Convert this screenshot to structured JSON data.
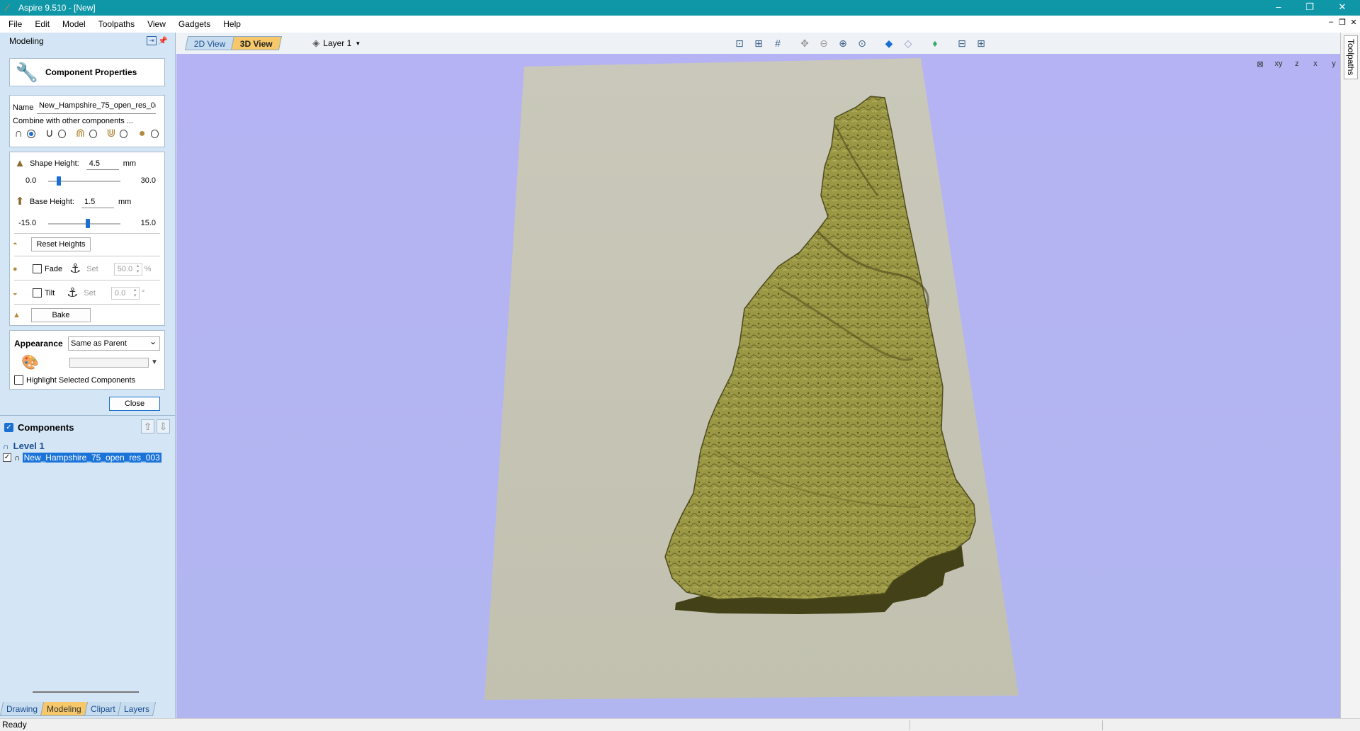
{
  "window": {
    "title": "Aspire 9.510 - [New]",
    "minimize": "–",
    "maximize": "❐",
    "close": "✕"
  },
  "menu": [
    "File",
    "Edit",
    "Model",
    "Toolpaths",
    "View",
    "Gadgets",
    "Help"
  ],
  "mdi_controls": [
    "–",
    "❐",
    "✕"
  ],
  "panel": {
    "title": "Modeling",
    "pin_icon": "pin-icon",
    "component_properties_label": "Component Properties",
    "name_label": "Name",
    "name_value": "New_Hampshire_75_open_res_0(",
    "combine_label": "Combine with other components ...",
    "combine_modes": [
      "add",
      "subtract",
      "merge",
      "low",
      "multiply"
    ],
    "shape_height_label": "Shape Height:",
    "shape_height_value": "4.5",
    "shape_height_unit": "mm",
    "shape_height_min": "0.0",
    "shape_height_max": "30.0",
    "shape_height_level": 0.15,
    "base_height_label": "Base Height:",
    "base_height_value": "1.5",
    "base_height_unit": "mm",
    "base_height_min": "-15.0",
    "base_height_max": "15.0",
    "base_height_level": 0.55,
    "reset_heights_label": "Reset Heights",
    "fade_label": "Fade",
    "fade_set_label": "Set",
    "fade_value": "50.0",
    "fade_unit": "%",
    "tilt_label": "Tilt",
    "tilt_set_label": "Set",
    "tilt_value": "0.0",
    "tilt_unit": "°",
    "bake_label": "Bake",
    "appearance_label": "Appearance",
    "appearance_value": "Same as Parent",
    "highlight_label": "Highlight Selected Components",
    "close_label": "Close"
  },
  "components": {
    "title": "Components",
    "level_label": "Level 1",
    "item_label": "New_Hampshire_75_open_res_003"
  },
  "bottom_tabs": [
    {
      "label": "Drawing",
      "active": false
    },
    {
      "label": "Modeling",
      "active": true
    },
    {
      "label": "Clipart",
      "active": false
    },
    {
      "label": "Layers",
      "active": false
    }
  ],
  "view_tabs": [
    {
      "label": "2D View",
      "active": false
    },
    {
      "label": "3D View",
      "active": true
    }
  ],
  "layer_label": "Layer 1",
  "toolbar_icons": [
    "zoom-fit-icon",
    "zoom-box-icon",
    "grid-icon",
    "pan-icon",
    "zoom-out-icon",
    "zoom-in-icon",
    "zoom-window-icon",
    "shading-icon",
    "wireframe-icon",
    "material-icon",
    "split-horizontal-icon",
    "split-vertical-icon"
  ],
  "orientation_labels": [
    "⊠",
    "xy",
    "z",
    "x",
    "y"
  ],
  "right_tab_label": "Toolpaths",
  "status": {
    "text": "Ready"
  },
  "colors": {
    "titlebar": "#0f97a8",
    "viewport_bg": "#b3b5f2",
    "material_plane": "#c6c5b5",
    "terrain": "#9b9845",
    "terrain_shadow": "#434117",
    "selection": "#1a73d9"
  }
}
